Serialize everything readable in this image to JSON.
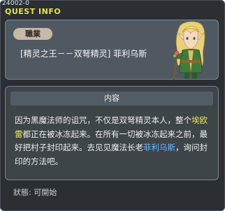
{
  "window": {
    "quest_id": "24002-0",
    "title": "QUEST INFO"
  },
  "npc": {
    "job_label": "職業",
    "name_line": "[精灵之王－－双弩精灵] 菲利乌斯"
  },
  "content": {
    "header": "内容",
    "text_segments": [
      {
        "text": "因为黑魔法师的诅咒，不仅是双弩精灵本人，整个",
        "style": "normal"
      },
      {
        "text": "埃欧雷",
        "style": "yellow"
      },
      {
        "text": "都正在被冰冻起来。在所有一切被冰冻起来之前，最好把村子封印起来。去见见魔法长老",
        "style": "normal"
      },
      {
        "text": "菲利乌斯",
        "style": "blue"
      },
      {
        "text": "，询问封印的方法吧。",
        "style": "normal"
      }
    ]
  },
  "status": {
    "text": "狀態:  可開始"
  },
  "colors": {
    "window_bg": "#2b2f33",
    "highlight_yellow": "#f0ea4a",
    "highlight_blue": "#69b6ff",
    "title_yellow": "#e8e24a"
  }
}
